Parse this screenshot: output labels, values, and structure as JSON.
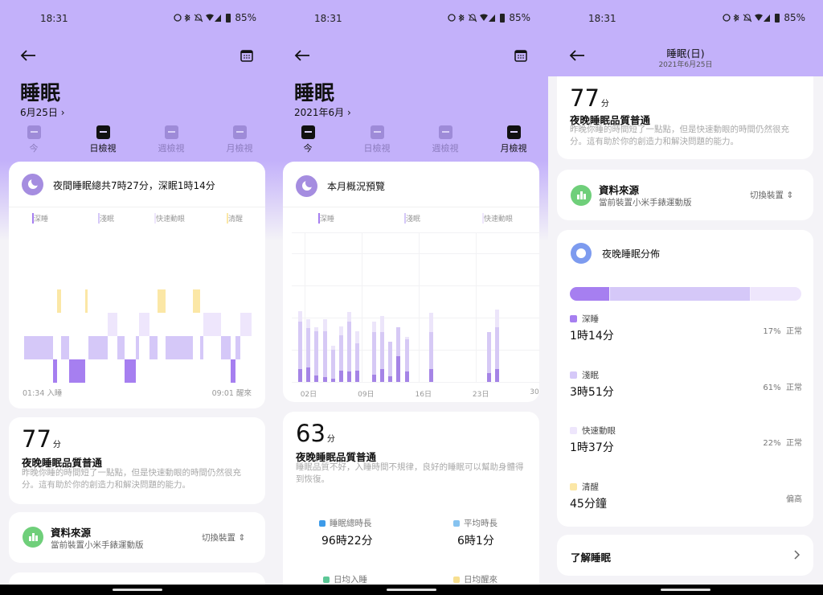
{
  "status": {
    "time": "18:31",
    "battery": "85%"
  },
  "colors": {
    "header": "#c3b1fa",
    "deep": "#a67ff0",
    "light": "#d5c8f8",
    "rem": "#eee6fc",
    "awake": "#fbe7a6"
  },
  "p1": {
    "title": "睡眠",
    "date": "6月25日 ›",
    "tabs": [
      "今",
      "日檢視",
      "週檢視",
      "月檢視"
    ],
    "summary": "夜間睡眠總共7時27分，深眠1時14分",
    "legend": [
      "深睡",
      "淺眠",
      "快速動眼",
      "清醒"
    ],
    "start_label": "01:34 入睡",
    "end_label": "09:01 醒來",
    "score": {
      "value": "77",
      "unit": "分",
      "title": "夜晚睡眠品質普通",
      "desc": "昨晚你睡的時間短了一點點，但是快速動眼的時間仍然很充分。這有助於你的創造力和解決問題的能力。"
    },
    "source": {
      "title": "資料來源",
      "subtitle": "當前裝置小米手錶運動版",
      "action": "切換裝置"
    }
  },
  "p2": {
    "title": "睡眠",
    "date": "2021年6月 ›",
    "tabs": [
      "今",
      "日檢視",
      "週檢視",
      "月檢視"
    ],
    "summary": "本月概況預覽",
    "legend": [
      "深睡",
      "淺眠",
      "快速動眼"
    ],
    "score": {
      "value": "63",
      "unit": "分",
      "title": "夜晚睡眠品質普通",
      "desc": "睡眠品質不好，入睡時間不規律，良好的睡眠可以幫助身體得到恢復。"
    },
    "stats": [
      {
        "label": "睡眠總時長",
        "value": "96時22分",
        "color": "#3d9be9"
      },
      {
        "label": "平均時長",
        "value": "6時1分",
        "color": "#86c3f0"
      },
      {
        "label": "日均入睡",
        "value": "",
        "color": "#5cc796"
      },
      {
        "label": "日均醒來",
        "value": "",
        "color": "#f7df8f"
      }
    ]
  },
  "p3": {
    "title": "睡眠(日)",
    "subtitle": "2021年6月25日",
    "score": {
      "value": "77",
      "unit": "分",
      "title": "夜晚睡眠品質普通",
      "desc": "昨晚你睡的時間短了一點點，但是快速動眼的時間仍然很充分。這有助於你的創造力和解決問題的能力。"
    },
    "source": {
      "title": "資料來源",
      "subtitle": "當前裝置小米手錶運動版",
      "action": "切換裝置"
    },
    "dist_title": "夜晚睡眠分佈",
    "dist": [
      {
        "label": "深睡",
        "value": "1時14分",
        "pct": "17%",
        "status": "正常",
        "color": "#a67ff0",
        "fraction": 0.17
      },
      {
        "label": "淺眠",
        "value": "3時51分",
        "pct": "61%",
        "status": "正常",
        "color": "#d5c8f8",
        "fraction": 0.61
      },
      {
        "label": "快速動眼",
        "value": "1時37分",
        "pct": "22%",
        "status": "正常",
        "color": "#eee6fc",
        "fraction": 0.22
      },
      {
        "label": "清醒",
        "value": "45分鐘",
        "pct": "",
        "status": "偏高",
        "color": "#fbe7a6",
        "fraction": 0
      }
    ],
    "learn": "了解睡眠"
  },
  "chart_data": [
    {
      "type": "timeline",
      "title": "夜間睡眠總共7時27分，深眠1時14分",
      "total_minutes": 447,
      "levels": [
        "awake",
        "rem",
        "light",
        "deep"
      ],
      "segments": [
        [
          "light",
          0,
          57
        ],
        [
          "deep",
          57,
          65
        ],
        [
          "awake",
          65,
          73
        ],
        [
          "light",
          73,
          88
        ],
        [
          "deep",
          88,
          120
        ],
        [
          "awake",
          120,
          125
        ],
        [
          "light",
          126,
          164
        ],
        [
          "rem",
          164,
          183
        ],
        [
          "light",
          183,
          197
        ],
        [
          "deep",
          197,
          220
        ],
        [
          "light",
          220,
          226
        ],
        [
          "rem",
          226,
          246
        ],
        [
          "light",
          246,
          262
        ],
        [
          "awake",
          262,
          278
        ],
        [
          "light",
          278,
          332
        ],
        [
          "awake",
          332,
          346
        ],
        [
          "light",
          346,
          352
        ],
        [
          "rem",
          352,
          387
        ],
        [
          "light",
          387,
          406
        ],
        [
          "deep",
          406,
          415
        ],
        [
          "light",
          415,
          425
        ],
        [
          "rem",
          425,
          447
        ]
      ]
    },
    {
      "type": "bar",
      "stacked": true,
      "title": "本月概況預覽",
      "ylabel": "hours",
      "xticks": [
        "02日",
        "09日",
        "16日",
        "23日",
        "30"
      ],
      "days": [
        1,
        2,
        3,
        4,
        5,
        6,
        7,
        8,
        10,
        11,
        12,
        13,
        14,
        17,
        24,
        25
      ],
      "series": [
        {
          "name": "深睡",
          "values": [
            1.6,
            1.8,
            0.8,
            0.6,
            0.4,
            1.4,
            1.3,
            1.4,
            0.9,
            1.6,
            0.7,
            3.2,
            1.3,
            1.6,
            1.1,
            1.6
          ]
        },
        {
          "name": "淺眠",
          "values": [
            5.9,
            4.9,
            5.5,
            5.7,
            3.6,
            4.4,
            6.2,
            3.4,
            5.3,
            4.6,
            4.3,
            3.6,
            4.0,
            4.6,
            5.1,
            5.2
          ]
        },
        {
          "name": "快速動眼",
          "values": [
            1.3,
            1.1,
            0.5,
            1.5,
            0.5,
            1.1,
            1.2,
            1.5,
            1.3,
            2.0,
            0,
            0,
            0.3,
            2.4,
            0,
            2.2
          ]
        }
      ]
    }
  ]
}
